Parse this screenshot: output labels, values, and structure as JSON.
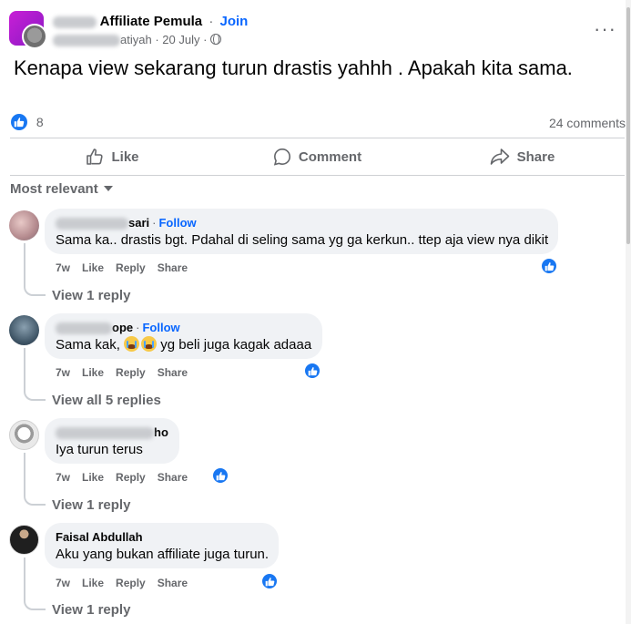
{
  "post": {
    "group_name": "Affiliate Pemula",
    "separator": "·",
    "join_label": "Join",
    "author_visible": "atiyah",
    "date": "20 July",
    "text": "Kenapa view sekarang turun drastis yahhh . Apakah kita sama.",
    "reaction_count": "8",
    "comment_count": "24 comments"
  },
  "actions": {
    "like": "Like",
    "comment": "Comment",
    "share": "Share"
  },
  "sort_label": "Most relevant",
  "comments": [
    {
      "name_visible": "sari",
      "follow": "Follow",
      "text": "Sama ka.. drastis bgt. Pdahal di seling sama yg ga kerkun.. ttep aja view nya dikit",
      "time": "7w",
      "like": "Like",
      "reply": "Reply",
      "share": "Share",
      "replies": "View 1 reply"
    },
    {
      "name_visible": "ope",
      "follow": "Follow",
      "text_before": "Sama kak,",
      "text_after": "yg beli juga kagak adaaa",
      "time": "7w",
      "like": "Like",
      "reply": "Reply",
      "share": "Share",
      "replies": "View all 5 replies"
    },
    {
      "name_visible": "ho",
      "text": "Iya turun terus",
      "time": "7w",
      "like": "Like",
      "reply": "Reply",
      "share": "Share",
      "replies": "View 1 reply"
    },
    {
      "name": "Faisal Abdullah",
      "text": "Aku yang bukan affiliate juga turun.",
      "time": "7w",
      "like": "Like",
      "reply": "Reply",
      "share": "Share",
      "replies": "View 1 reply"
    }
  ],
  "icons": {
    "more": "more-dots-icon",
    "like": "thumbs-up-icon",
    "comment": "speech-bubble-icon",
    "share": "share-arrow-icon",
    "globe": "globe-icon"
  },
  "colors": {
    "accent": "#0866ff",
    "like_blue": "#1877f2",
    "muted": "#65676b",
    "bubble": "#f0f2f5"
  }
}
